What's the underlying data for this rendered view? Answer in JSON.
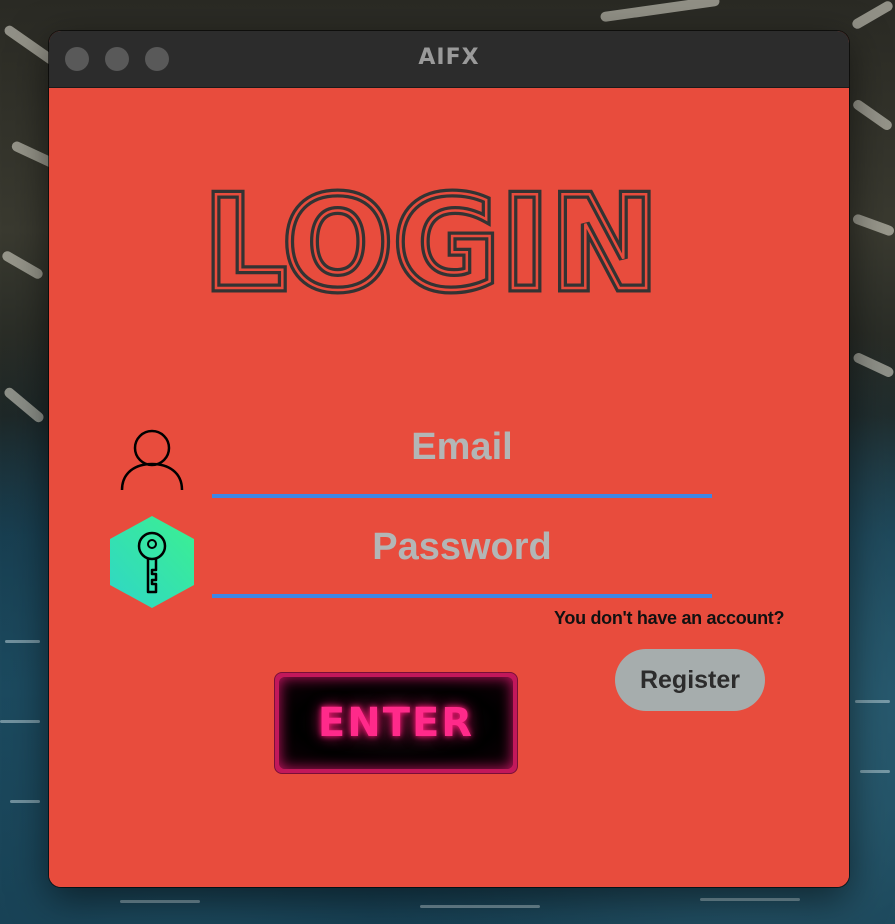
{
  "window": {
    "title": "AIFX"
  },
  "login": {
    "heading": "LOGIN",
    "email_placeholder": "Email",
    "email_value": "",
    "password_placeholder": "Password",
    "password_value": "",
    "no_account_text": "You don't have an account?",
    "register_label": "Register",
    "enter_label": "ENTER"
  },
  "icons": {
    "user": "user-outline-icon",
    "key": "key-icon"
  },
  "colors": {
    "background": "#e84c3d",
    "title_bar": "#2c2c2c",
    "field_underline": "#3d86e6",
    "placeholder": "#b3b6b6",
    "register_button": "#a6adad",
    "enter_button_border": "#c2185b",
    "enter_text_glow": "#ff2a8a",
    "heading": "#333333"
  }
}
